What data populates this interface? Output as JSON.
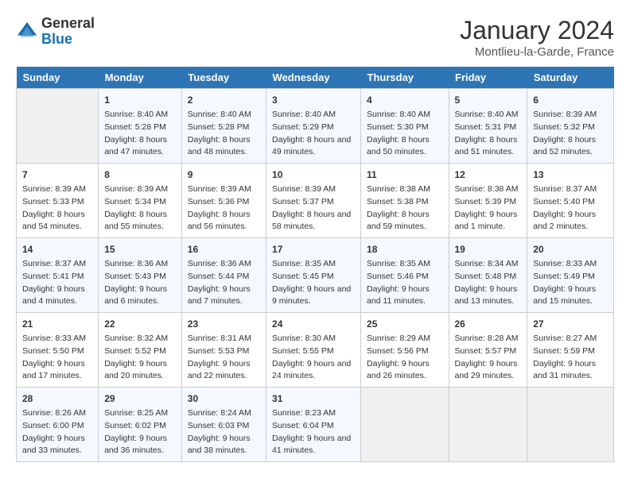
{
  "header": {
    "logo_general": "General",
    "logo_blue": "Blue",
    "month_title": "January 2024",
    "location": "Montlieu-la-Garde, France"
  },
  "days_of_week": [
    "Sunday",
    "Monday",
    "Tuesday",
    "Wednesday",
    "Thursday",
    "Friday",
    "Saturday"
  ],
  "weeks": [
    [
      {
        "day": null
      },
      {
        "day": 1,
        "sunrise": "Sunrise: 8:40 AM",
        "sunset": "Sunset: 5:28 PM",
        "daylight": "Daylight: 8 hours and 47 minutes."
      },
      {
        "day": 2,
        "sunrise": "Sunrise: 8:40 AM",
        "sunset": "Sunset: 5:28 PM",
        "daylight": "Daylight: 8 hours and 48 minutes."
      },
      {
        "day": 3,
        "sunrise": "Sunrise: 8:40 AM",
        "sunset": "Sunset: 5:29 PM",
        "daylight": "Daylight: 8 hours and 49 minutes."
      },
      {
        "day": 4,
        "sunrise": "Sunrise: 8:40 AM",
        "sunset": "Sunset: 5:30 PM",
        "daylight": "Daylight: 8 hours and 50 minutes."
      },
      {
        "day": 5,
        "sunrise": "Sunrise: 8:40 AM",
        "sunset": "Sunset: 5:31 PM",
        "daylight": "Daylight: 8 hours and 51 minutes."
      },
      {
        "day": 6,
        "sunrise": "Sunrise: 8:39 AM",
        "sunset": "Sunset: 5:32 PM",
        "daylight": "Daylight: 8 hours and 52 minutes."
      }
    ],
    [
      {
        "day": 7,
        "sunrise": "Sunrise: 8:39 AM",
        "sunset": "Sunset: 5:33 PM",
        "daylight": "Daylight: 8 hours and 54 minutes."
      },
      {
        "day": 8,
        "sunrise": "Sunrise: 8:39 AM",
        "sunset": "Sunset: 5:34 PM",
        "daylight": "Daylight: 8 hours and 55 minutes."
      },
      {
        "day": 9,
        "sunrise": "Sunrise: 8:39 AM",
        "sunset": "Sunset: 5:36 PM",
        "daylight": "Daylight: 8 hours and 56 minutes."
      },
      {
        "day": 10,
        "sunrise": "Sunrise: 8:39 AM",
        "sunset": "Sunset: 5:37 PM",
        "daylight": "Daylight: 8 hours and 58 minutes."
      },
      {
        "day": 11,
        "sunrise": "Sunrise: 8:38 AM",
        "sunset": "Sunset: 5:38 PM",
        "daylight": "Daylight: 8 hours and 59 minutes."
      },
      {
        "day": 12,
        "sunrise": "Sunrise: 8:38 AM",
        "sunset": "Sunset: 5:39 PM",
        "daylight": "Daylight: 9 hours and 1 minute."
      },
      {
        "day": 13,
        "sunrise": "Sunrise: 8:37 AM",
        "sunset": "Sunset: 5:40 PM",
        "daylight": "Daylight: 9 hours and 2 minutes."
      }
    ],
    [
      {
        "day": 14,
        "sunrise": "Sunrise: 8:37 AM",
        "sunset": "Sunset: 5:41 PM",
        "daylight": "Daylight: 9 hours and 4 minutes."
      },
      {
        "day": 15,
        "sunrise": "Sunrise: 8:36 AM",
        "sunset": "Sunset: 5:43 PM",
        "daylight": "Daylight: 9 hours and 6 minutes."
      },
      {
        "day": 16,
        "sunrise": "Sunrise: 8:36 AM",
        "sunset": "Sunset: 5:44 PM",
        "daylight": "Daylight: 9 hours and 7 minutes."
      },
      {
        "day": 17,
        "sunrise": "Sunrise: 8:35 AM",
        "sunset": "Sunset: 5:45 PM",
        "daylight": "Daylight: 9 hours and 9 minutes."
      },
      {
        "day": 18,
        "sunrise": "Sunrise: 8:35 AM",
        "sunset": "Sunset: 5:46 PM",
        "daylight": "Daylight: 9 hours and 11 minutes."
      },
      {
        "day": 19,
        "sunrise": "Sunrise: 8:34 AM",
        "sunset": "Sunset: 5:48 PM",
        "daylight": "Daylight: 9 hours and 13 minutes."
      },
      {
        "day": 20,
        "sunrise": "Sunrise: 8:33 AM",
        "sunset": "Sunset: 5:49 PM",
        "daylight": "Daylight: 9 hours and 15 minutes."
      }
    ],
    [
      {
        "day": 21,
        "sunrise": "Sunrise: 8:33 AM",
        "sunset": "Sunset: 5:50 PM",
        "daylight": "Daylight: 9 hours and 17 minutes."
      },
      {
        "day": 22,
        "sunrise": "Sunrise: 8:32 AM",
        "sunset": "Sunset: 5:52 PM",
        "daylight": "Daylight: 9 hours and 20 minutes."
      },
      {
        "day": 23,
        "sunrise": "Sunrise: 8:31 AM",
        "sunset": "Sunset: 5:53 PM",
        "daylight": "Daylight: 9 hours and 22 minutes."
      },
      {
        "day": 24,
        "sunrise": "Sunrise: 8:30 AM",
        "sunset": "Sunset: 5:55 PM",
        "daylight": "Daylight: 9 hours and 24 minutes."
      },
      {
        "day": 25,
        "sunrise": "Sunrise: 8:29 AM",
        "sunset": "Sunset: 5:56 PM",
        "daylight": "Daylight: 9 hours and 26 minutes."
      },
      {
        "day": 26,
        "sunrise": "Sunrise: 8:28 AM",
        "sunset": "Sunset: 5:57 PM",
        "daylight": "Daylight: 9 hours and 29 minutes."
      },
      {
        "day": 27,
        "sunrise": "Sunrise: 8:27 AM",
        "sunset": "Sunset: 5:59 PM",
        "daylight": "Daylight: 9 hours and 31 minutes."
      }
    ],
    [
      {
        "day": 28,
        "sunrise": "Sunrise: 8:26 AM",
        "sunset": "Sunset: 6:00 PM",
        "daylight": "Daylight: 9 hours and 33 minutes."
      },
      {
        "day": 29,
        "sunrise": "Sunrise: 8:25 AM",
        "sunset": "Sunset: 6:02 PM",
        "daylight": "Daylight: 9 hours and 36 minutes."
      },
      {
        "day": 30,
        "sunrise": "Sunrise: 8:24 AM",
        "sunset": "Sunset: 6:03 PM",
        "daylight": "Daylight: 9 hours and 38 minutes."
      },
      {
        "day": 31,
        "sunrise": "Sunrise: 8:23 AM",
        "sunset": "Sunset: 6:04 PM",
        "daylight": "Daylight: 9 hours and 41 minutes."
      },
      {
        "day": null
      },
      {
        "day": null
      },
      {
        "day": null
      }
    ]
  ]
}
